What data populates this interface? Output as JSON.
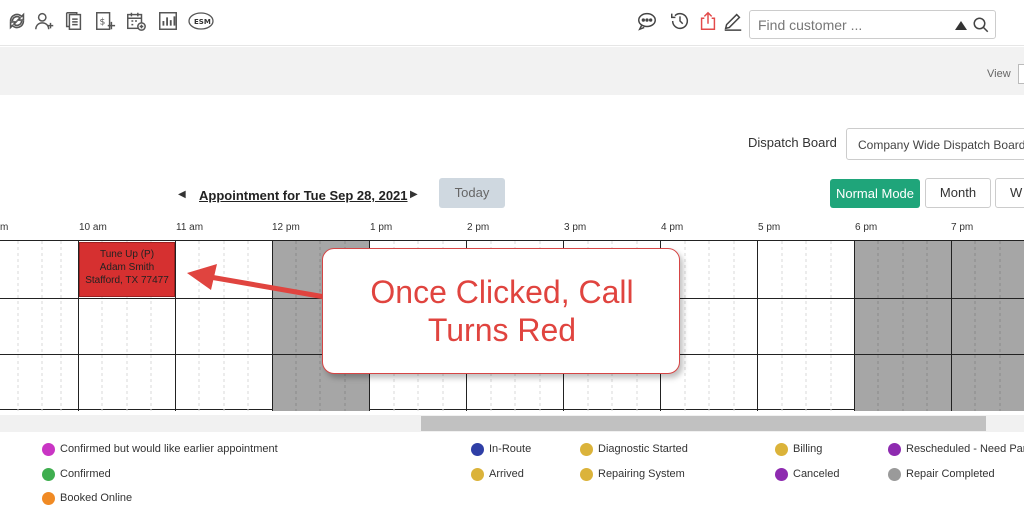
{
  "toolbar": {
    "icons": [
      "refresh-icon",
      "add-user-icon",
      "documents-icon",
      "invoice-add-icon",
      "calendar-add-icon",
      "bar-chart-icon",
      "esm-icon",
      "chat-icon",
      "history-icon",
      "export-icon",
      "edit-icon"
    ],
    "esm_label": "ESM",
    "search_placeholder": "Find customer ..."
  },
  "view": {
    "label": "View"
  },
  "dispatch": {
    "label": "Dispatch Board",
    "selected": "Company Wide Dispatch Board"
  },
  "datenav": {
    "title": "Appointment for Tue Sep 28, 2021",
    "today": "Today",
    "normal_mode": "Normal Mode",
    "month": "Month",
    "w": "W"
  },
  "timeline": {
    "hours": [
      "m",
      "10 am",
      "11 am",
      "12 pm",
      "1 pm",
      "2 pm",
      "3 pm",
      "4 pm",
      "5 pm",
      "6 pm",
      "7 pm"
    ],
    "rows": 3
  },
  "appointment": {
    "title": "Tune Up (P)",
    "customer": "Adam Smith",
    "location": "Stafford, TX 77477",
    "color": "#d63030"
  },
  "callout": {
    "line1": "Once Clicked, Call",
    "line2": "Turns Red",
    "color": "#e0443f"
  },
  "legend": [
    {
      "label": "Confirmed but would like earlier appointment",
      "color": "#c935c4"
    },
    {
      "label": "Confirmed",
      "color": "#3fae4f"
    },
    {
      "label": "Booked Online",
      "color": "#f08a24"
    },
    {
      "label": "In-Route",
      "color": "#2f3fa6"
    },
    {
      "label": "Arrived",
      "color": "#dbb33a"
    },
    {
      "label": "Diagnostic Started",
      "color": "#dbb33a"
    },
    {
      "label": "Repairing System",
      "color": "#dbb33a"
    },
    {
      "label": "Billing",
      "color": "#dbb33a"
    },
    {
      "label": "Canceled",
      "color": "#8e2bb0"
    },
    {
      "label": "Rescheduled - Need Part",
      "color": "#8e2bb0"
    },
    {
      "label": "Repair Completed",
      "color": "#9a9a9a"
    }
  ]
}
